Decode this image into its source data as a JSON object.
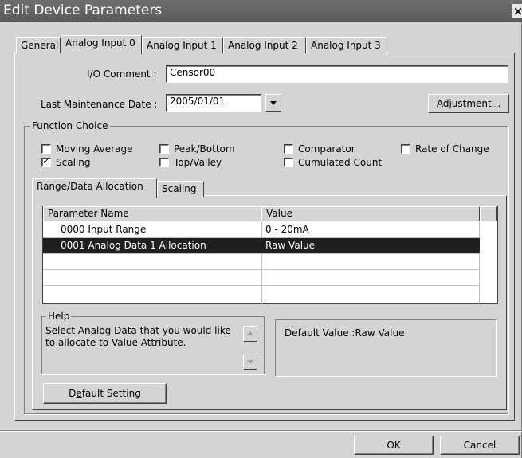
{
  "window": {
    "title": "Edit Device Parameters",
    "close_glyph": "×"
  },
  "tabs": [
    {
      "label": "General"
    },
    {
      "label": "Analog Input 0"
    },
    {
      "label": "Analog Input 1"
    },
    {
      "label": "Analog Input 2"
    },
    {
      "label": "Analog Input 3"
    }
  ],
  "io_comment": {
    "label": "I/O Comment :",
    "value": "Censor00"
  },
  "maintenance": {
    "label": "Last Maintenance Date :",
    "value": "2005/01/01"
  },
  "adjustment_button": {
    "label_prefix": "",
    "label_ul": "A",
    "label_rest": "djustment..."
  },
  "function_choice": {
    "label": "Function Choice",
    "options": [
      {
        "label": "Moving Average",
        "checked": false
      },
      {
        "label": "Peak/Bottom",
        "checked": false
      },
      {
        "label": "Comparator",
        "checked": false
      },
      {
        "label": "Rate of Change",
        "checked": false
      },
      {
        "label": "Scaling",
        "checked": true
      },
      {
        "label": "Top/Valley",
        "checked": false
      },
      {
        "label": "Cumulated Count",
        "checked": false
      }
    ]
  },
  "inner_tabs": [
    {
      "label": "Range/Data Allocation"
    },
    {
      "label": "Scaling"
    }
  ],
  "grid": {
    "columns": [
      "Parameter Name",
      "Value"
    ],
    "rows": [
      {
        "name": "0000 Input Range",
        "value": "0 - 20mA"
      },
      {
        "name": "0001 Analog Data 1 Allocation",
        "value": "Raw Value"
      }
    ]
  },
  "help": {
    "label": "Help",
    "text_line1": "Select Analog Data that you would like",
    "text_line2": "to allocate to Value Attribute.",
    "default_value": "Default Value :Raw Value"
  },
  "default_setting_button": {
    "label_prefix": "D",
    "label_ul": "e",
    "label_rest": "fault Setting"
  },
  "footer": {
    "ok": "OK",
    "cancel": "Cancel"
  }
}
